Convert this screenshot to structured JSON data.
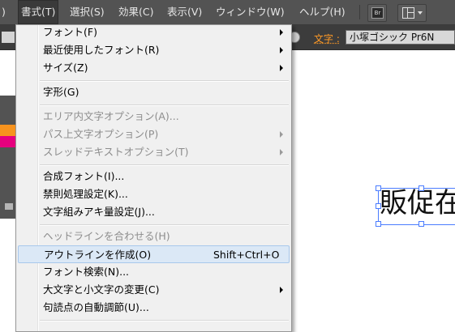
{
  "menubar": {
    "edge_label": ")",
    "format": "書式(T)",
    "select": "選択(S)",
    "effect": "効果(C)",
    "view": "表示(V)",
    "window": "ウィンドウ(W)",
    "help": "ヘルプ(H)",
    "bridge_icon_text": "Br"
  },
  "controlbar": {
    "font_label": "文字 :",
    "font_value": "小塚ゴシック Pr6N"
  },
  "canvas": {
    "text": "販促在"
  },
  "colors": {
    "menubar_bg": "#535353",
    "control_bg": "#3c3c3c",
    "accent_orange": "#f7931e",
    "accent_pink": "#e6007e",
    "font_label_color": "#ff9a26",
    "highlight_bg": "#dbe8f6",
    "selection_blue": "#4a7cff"
  },
  "format_menu": {
    "items": [
      {
        "label": "フォント(F)",
        "submenu": true,
        "enabled": true
      },
      {
        "label": "最近使用したフォント(R)",
        "submenu": true,
        "enabled": true
      },
      {
        "label": "サイズ(Z)",
        "submenu": true,
        "enabled": true
      },
      {
        "label": "字形(G)",
        "enabled": true
      },
      {
        "label": "エリア内文字オプション(A)...",
        "enabled": false
      },
      {
        "label": "パス上文字オプション(P)",
        "submenu": true,
        "enabled": false
      },
      {
        "label": "スレッドテキストオプション(T)",
        "submenu": true,
        "enabled": false
      },
      {
        "label": "合成フォント(I)...",
        "enabled": true
      },
      {
        "label": "禁則処理設定(K)...",
        "enabled": true
      },
      {
        "label": "文字組みアキ量設定(J)...",
        "enabled": true
      },
      {
        "label": "ヘッドラインを合わせる(H)",
        "enabled": false
      },
      {
        "label": "アウトラインを作成(O)",
        "shortcut": "Shift+Ctrl+O",
        "enabled": true,
        "highlighted": true
      },
      {
        "label": "フォント検索(N)...",
        "enabled": true
      },
      {
        "label": "大文字と小文字の変更(C)",
        "submenu": true,
        "enabled": true
      },
      {
        "label": "句読点の自動調節(U)...",
        "enabled": true
      }
    ]
  }
}
